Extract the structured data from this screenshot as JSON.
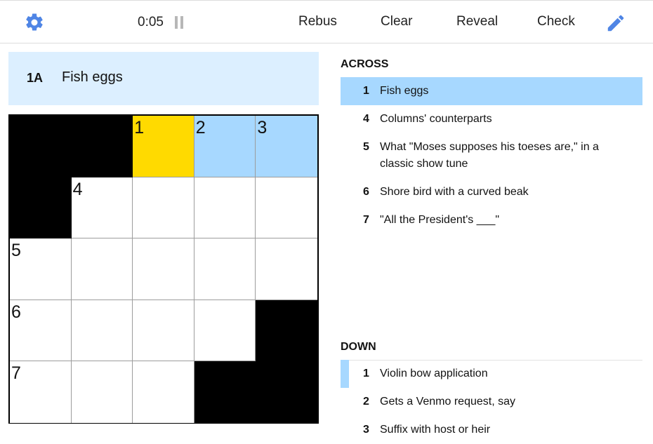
{
  "toolbar": {
    "settings_icon": "gear-icon",
    "timer": "0:05",
    "pause_icon": "pause-icon",
    "rebus_label": "Rebus",
    "clear_label": "Clear",
    "reveal_label": "Reveal",
    "check_label": "Check",
    "pencil_icon": "pencil-icon"
  },
  "current_clue": {
    "number": "1A",
    "text": "Fish eggs"
  },
  "grid": {
    "size": 5,
    "cells": [
      [
        {
          "type": "black"
        },
        {
          "type": "black"
        },
        {
          "type": "selected",
          "number": "1"
        },
        {
          "type": "word",
          "number": "2"
        },
        {
          "type": "word",
          "number": "3"
        }
      ],
      [
        {
          "type": "black"
        },
        {
          "type": "white",
          "number": "4"
        },
        {
          "type": "white"
        },
        {
          "type": "white"
        },
        {
          "type": "white"
        }
      ],
      [
        {
          "type": "white",
          "number": "5"
        },
        {
          "type": "white"
        },
        {
          "type": "white"
        },
        {
          "type": "white"
        },
        {
          "type": "white"
        }
      ],
      [
        {
          "type": "white",
          "number": "6"
        },
        {
          "type": "white"
        },
        {
          "type": "white"
        },
        {
          "type": "white"
        },
        {
          "type": "black"
        }
      ],
      [
        {
          "type": "white",
          "number": "7"
        },
        {
          "type": "white"
        },
        {
          "type": "white"
        },
        {
          "type": "black"
        },
        {
          "type": "black"
        }
      ]
    ]
  },
  "across": {
    "heading": "ACROSS",
    "clues": [
      {
        "number": "1",
        "text": "Fish eggs"
      },
      {
        "number": "4",
        "text": "Columns' counterparts"
      },
      {
        "number": "5",
        "text": "What \"Moses supposes his toeses are,\" in a classic show tune"
      },
      {
        "number": "6",
        "text": "Shore bird with a curved beak"
      },
      {
        "number": "7",
        "text": "\"All the President's ___\""
      }
    ]
  },
  "down": {
    "heading": "DOWN",
    "clues": [
      {
        "number": "1",
        "text": "Violin bow application"
      },
      {
        "number": "2",
        "text": "Gets a Venmo request, say"
      },
      {
        "number": "3",
        "text": "Suffix with host or heir"
      }
    ]
  },
  "colors": {
    "selected_cell": "#ffda00",
    "highlight": "#a7d8ff",
    "clue_bar": "#dcefff",
    "icon_blue": "#4f85e5"
  }
}
